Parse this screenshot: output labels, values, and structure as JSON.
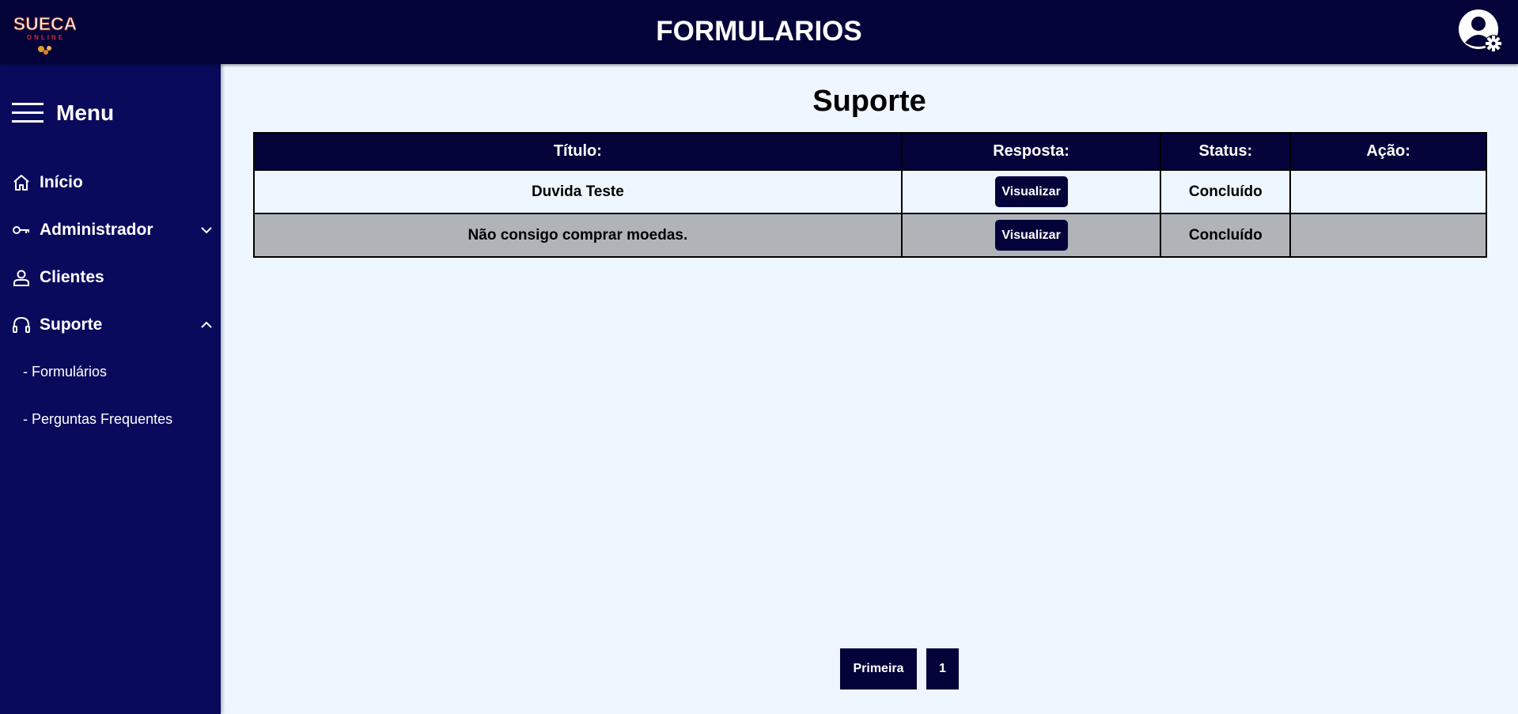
{
  "header": {
    "title": "FORMULARIOS",
    "logo": {
      "line1": "SUECA",
      "line2": "ONLINE"
    },
    "user_icon": "user-settings-icon",
    "background_color": "#03033a"
  },
  "sidebar": {
    "menu_label": "Menu",
    "background_color": "#0a0a5c",
    "items": [
      {
        "label": "Início",
        "icon": "home-icon"
      },
      {
        "label": "Administrador",
        "icon": "key-icon",
        "expandable": true,
        "expanded": false
      },
      {
        "label": "Clientes",
        "icon": "person-icon"
      },
      {
        "label": "Suporte",
        "icon": "headset-icon",
        "expandable": true,
        "expanded": true
      }
    ],
    "subitems": [
      {
        "label": "- Formulários"
      },
      {
        "label": "- Perguntas Frequentes"
      }
    ]
  },
  "main": {
    "title": "Suporte",
    "table": {
      "headers": [
        "Título:",
        "Resposta:",
        "Status:",
        "Ação:"
      ],
      "rows": [
        {
          "titulo": "Duvida Teste",
          "resposta_button": "Visualizar",
          "status": "Concluído",
          "acao": ""
        },
        {
          "titulo": "Não consigo comprar moedas.",
          "resposta_button": "Visualizar",
          "status": "Concluído",
          "acao": ""
        }
      ],
      "row_colors": [
        "#eef6ff",
        "#b0b4b9"
      ]
    },
    "pagination": {
      "first_label": "Primeira",
      "pages": [
        "1"
      ]
    }
  }
}
